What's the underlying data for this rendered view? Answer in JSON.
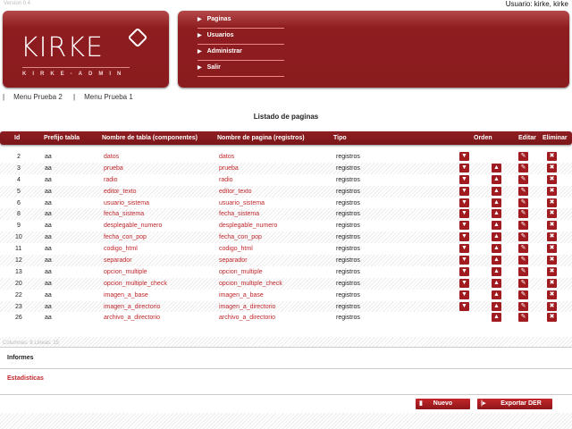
{
  "version": "Version 0.4",
  "user": "Usuario: kirke, kirke",
  "logo": {
    "text": "KIRKE",
    "sub": "KIRKE-ADMIN"
  },
  "nav": [
    "Paginas",
    "Usuarios",
    "Administrar",
    "Salir"
  ],
  "menu": [
    "Menu Prueba 2",
    "Menu Prueba 1"
  ],
  "title": "Listado de paginas",
  "headers": {
    "id": "Id",
    "prefix": "Prefijo tabla",
    "table": "Nombre de tabla (componentes)",
    "page": "Nombre de pagina (registros)",
    "type": "Tipo",
    "order": "Orden",
    "edit": "Editar",
    "delete": "Eliminar"
  },
  "rows": [
    {
      "id": "2",
      "prefix": "aa",
      "table": "datos",
      "page": "datos",
      "type": "registros",
      "down": true,
      "up": false
    },
    {
      "id": "3",
      "prefix": "aa",
      "table": "prueba",
      "page": "prueba",
      "type": "registros",
      "down": true,
      "up": true
    },
    {
      "id": "4",
      "prefix": "aa",
      "table": "radio",
      "page": "radio",
      "type": "registros",
      "down": true,
      "up": true
    },
    {
      "id": "5",
      "prefix": "aa",
      "table": "editor_texto",
      "page": "editor_texto",
      "type": "registros",
      "down": true,
      "up": true
    },
    {
      "id": "6",
      "prefix": "aa",
      "table": "usuario_sistema",
      "page": "usuario_sistema",
      "type": "registros",
      "down": true,
      "up": true
    },
    {
      "id": "8",
      "prefix": "aa",
      "table": "fecha_sistema",
      "page": "fecha_sistema",
      "type": "registros",
      "down": true,
      "up": true
    },
    {
      "id": "9",
      "prefix": "aa",
      "table": "desplegable_numero",
      "page": "desplegable_numero",
      "type": "registros",
      "down": true,
      "up": true
    },
    {
      "id": "10",
      "prefix": "aa",
      "table": "fecha_con_pop",
      "page": "fecha_con_pop",
      "type": "registros",
      "down": true,
      "up": true
    },
    {
      "id": "11",
      "prefix": "aa",
      "table": "codigo_html",
      "page": "codigo_html",
      "type": "registros",
      "down": true,
      "up": true
    },
    {
      "id": "12",
      "prefix": "aa",
      "table": "separador",
      "page": "separador",
      "type": "registros",
      "down": true,
      "up": true
    },
    {
      "id": "13",
      "prefix": "aa",
      "table": "opcion_multiple",
      "page": "opcion_multiple",
      "type": "registros",
      "down": true,
      "up": true
    },
    {
      "id": "20",
      "prefix": "aa",
      "table": "opcion_multiple_check",
      "page": "opcion_multiple_check",
      "type": "registros",
      "down": true,
      "up": true
    },
    {
      "id": "22",
      "prefix": "aa",
      "table": "imagen_a_base",
      "page": "imagen_a_base",
      "type": "registros",
      "down": true,
      "up": true
    },
    {
      "id": "23",
      "prefix": "aa",
      "table": "imagen_a_directorio",
      "page": "imagen_a_directorio",
      "type": "registros",
      "down": true,
      "up": true
    },
    {
      "id": "26",
      "prefix": "aa",
      "table": "archivo_a_directorio",
      "page": "archivo_a_directorio",
      "type": "registros",
      "down": false,
      "up": true
    }
  ],
  "info": "Columnas: 8  Lineas: 15",
  "sections": [
    "Informes",
    "Estadisticas"
  ],
  "buttons": {
    "new": "Nuevo",
    "export": "Exportar DER"
  },
  "colors": {
    "brand": "#8e1d20",
    "link": "#c0262b"
  }
}
